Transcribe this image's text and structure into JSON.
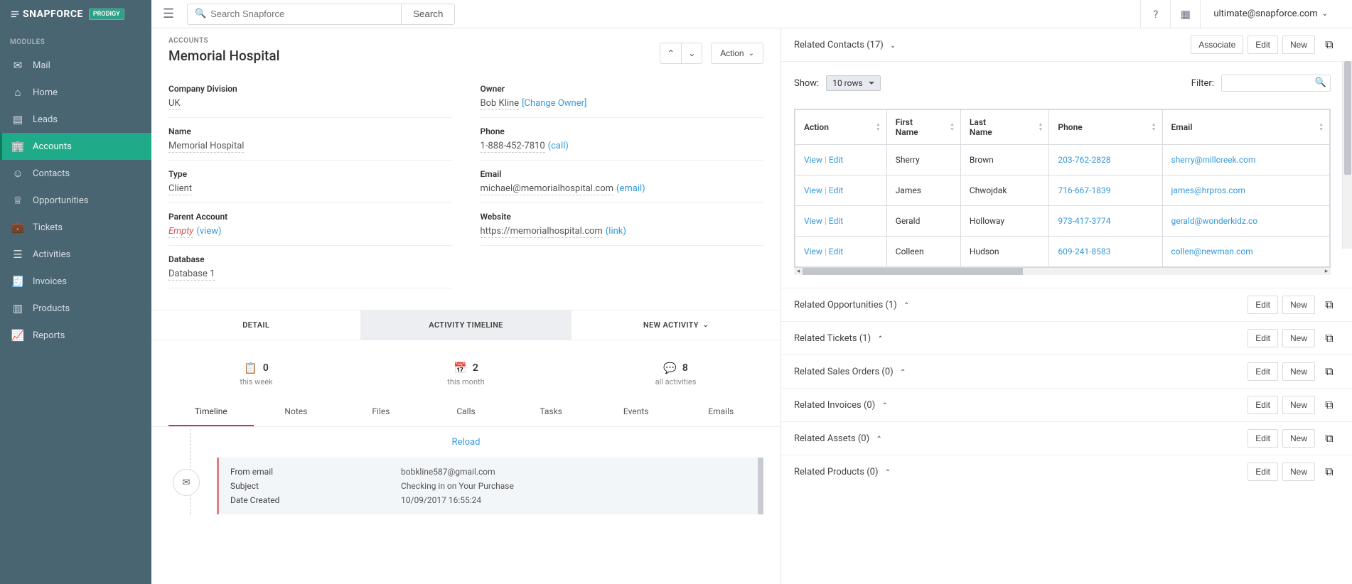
{
  "brand": {
    "name": "SNAPFORCE",
    "badge": "PRODIGY"
  },
  "search": {
    "placeholder": "Search Snapforce",
    "button": "Search"
  },
  "user_email": "ultimate@snapforce.com",
  "sidebar": {
    "section": "MODULES",
    "items": [
      {
        "label": "Mail"
      },
      {
        "label": "Home"
      },
      {
        "label": "Leads"
      },
      {
        "label": "Accounts",
        "active": true
      },
      {
        "label": "Contacts"
      },
      {
        "label": "Opportunities"
      },
      {
        "label": "Tickets"
      },
      {
        "label": "Activities"
      },
      {
        "label": "Invoices"
      },
      {
        "label": "Products"
      },
      {
        "label": "Reports"
      }
    ]
  },
  "page": {
    "breadcrumb": "ACCOUNTS",
    "title": "Memorial Hospital",
    "action_label": "Action"
  },
  "detail": {
    "left": [
      {
        "label": "Company Division",
        "value": "UK"
      },
      {
        "label": "Name",
        "value": "Memorial Hospital"
      },
      {
        "label": "Type",
        "value": "Client"
      },
      {
        "label": "Parent Account",
        "value": "Empty",
        "empty": true,
        "suffix": "(view)"
      },
      {
        "label": "Database",
        "value": "Database 1"
      }
    ],
    "right": [
      {
        "label": "Owner",
        "value": "Bob Kline",
        "suffix_link": "[Change Owner]"
      },
      {
        "label": "Phone",
        "value": "1-888-452-7810",
        "suffix": "(call)"
      },
      {
        "label": "Email",
        "value": "michael@memorialhospital.com",
        "suffix": "(email)"
      },
      {
        "label": "Website",
        "value": "https://memorialhospital.com",
        "suffix": "(link)"
      }
    ]
  },
  "tabs": {
    "detail": "DETAIL",
    "timeline": "ACTIVITY TIMELINE",
    "new": "NEW ACTIVITY"
  },
  "stats": [
    {
      "count": "0",
      "label": "this week"
    },
    {
      "count": "2",
      "label": "this month"
    },
    {
      "count": "8",
      "label": "all activities"
    }
  ],
  "subtabs": [
    "Timeline",
    "Notes",
    "Files",
    "Calls",
    "Tasks",
    "Events",
    "Emails"
  ],
  "reload": "Reload",
  "timeline_entry": {
    "from_label": "From email",
    "from_value": "bobkline587@gmail.com",
    "subject_label": "Subject",
    "subject_value": "Checking in on Your Purchase",
    "date_label": "Date Created",
    "date_value": "10/09/2017 16:55:24"
  },
  "related": {
    "contacts": {
      "title": "Related Contacts (17)",
      "associate": "Associate",
      "edit": "Edit",
      "new": "New",
      "show_label": "Show:",
      "show_value": "10 rows",
      "filter_label": "Filter:",
      "cols": [
        "Action",
        "First Name",
        "Last Name",
        "Phone",
        "Email"
      ],
      "action_view": "View",
      "action_edit": "Edit",
      "rows": [
        {
          "first": "Sherry",
          "last": "Brown",
          "phone": "203-762-2828",
          "email": "sherry@millcreek.com"
        },
        {
          "first": "James",
          "last": "Chwojdak",
          "phone": "716-667-1839",
          "email": "james@hrpros.com"
        },
        {
          "first": "Gerald",
          "last": "Holloway",
          "phone": "973-417-3774",
          "email": "gerald@wonderkidz.co"
        },
        {
          "first": "Colleen",
          "last": "Hudson",
          "phone": "609-241-8583",
          "email": "collen@newman.com"
        }
      ]
    },
    "sections": [
      {
        "title": "Related Opportunities (1)"
      },
      {
        "title": "Related Tickets (1)"
      },
      {
        "title": "Related Sales Orders (0)"
      },
      {
        "title": "Related Invoices (0)"
      },
      {
        "title": "Related Assets (0)"
      },
      {
        "title": "Related Products (0)"
      }
    ],
    "edit": "Edit",
    "new": "New"
  }
}
